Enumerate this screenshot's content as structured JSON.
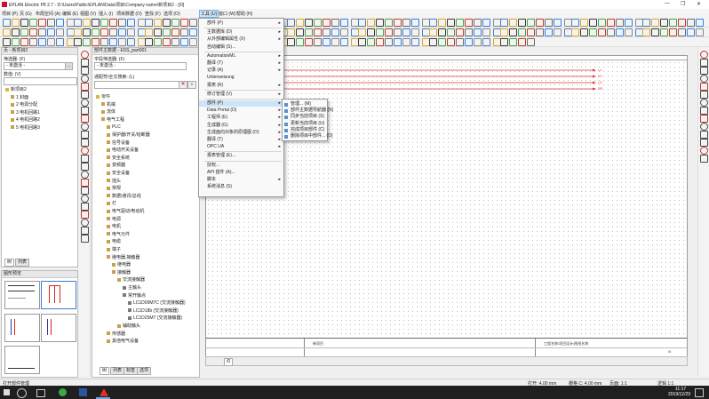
{
  "window": {
    "title": "EPLAN Electric P8 2.7 - D:\\Users\\Public\\EPLAN\\Data\\项目\\Company name\\新项目2 - [/0]",
    "controls": [
      "—",
      "❐",
      "✕"
    ]
  },
  "menubar": {
    "items": [
      "项目 (P)",
      "页 (G)",
      "布局空间 (A)",
      "编辑 (E)",
      "视图 (V)",
      "插入 (I)",
      "项目数据 (O)",
      "查找 (F)",
      "选项 (O)",
      "工具 (U)",
      "窗口 (W)",
      "帮助 (H)"
    ],
    "active_index": 9
  },
  "page_navigator": {
    "title": "页 - 新项目2",
    "filter_label": "筛选器: (F)",
    "filter_value": "- 未激活 -",
    "value_label": "数值: (V)",
    "tree": [
      {
        "label": "新项目2",
        "level": 0
      },
      {
        "label": "1 封面",
        "level": 1
      },
      {
        "label": "2 电源分配",
        "level": 1
      },
      {
        "label": "3 电机回路1",
        "level": 1
      },
      {
        "label": "4 电机回路2",
        "level": 1
      },
      {
        "label": "5 电机回路3",
        "level": 1
      }
    ],
    "tabs": [
      "树",
      "列表"
    ]
  },
  "graphic_preview": {
    "title": "图形预览"
  },
  "parts_navigator": {
    "title": "部件主数据 - ESS_part001",
    "field_label": "字段筛选器: (F)",
    "field_value": "- 未激活 -",
    "fulltext_label": "通配符/全文搜索: (L)",
    "tree": [
      {
        "label": "零件",
        "level": 0
      },
      {
        "label": "机械",
        "level": 1
      },
      {
        "label": "流体",
        "level": 1
      },
      {
        "label": "电气工程",
        "level": 1
      },
      {
        "label": "PLC",
        "level": 2
      },
      {
        "label": "保护器/开关/熔断器",
        "level": 2
      },
      {
        "label": "信号设备",
        "level": 2
      },
      {
        "label": "电动开关设备",
        "level": 2
      },
      {
        "label": "安全系统",
        "level": 2
      },
      {
        "label": "变频器",
        "level": 2
      },
      {
        "label": "安全设备",
        "level": 2
      },
      {
        "label": "插头",
        "level": 2
      },
      {
        "label": "常规",
        "level": 2
      },
      {
        "label": "数据/通讯/总线",
        "level": 2
      },
      {
        "label": "灯",
        "level": 2
      },
      {
        "label": "电气驱动/电动机",
        "level": 2
      },
      {
        "label": "电源",
        "level": 2
      },
      {
        "label": "电机",
        "level": 2
      },
      {
        "label": "电气元件",
        "level": 2
      },
      {
        "label": "电缆",
        "level": 2
      },
      {
        "label": "端子",
        "level": 2
      },
      {
        "label": "继电器,接触器",
        "level": 2
      },
      {
        "label": "继电器",
        "level": 3
      },
      {
        "label": "接触器",
        "level": 3
      },
      {
        "label": "交流接触器",
        "level": 4
      },
      {
        "label": "主触头",
        "level": 5
      },
      {
        "label": "常开触点",
        "level": 5
      },
      {
        "label": "LC1D09M7C (交流接触器)",
        "level": 6
      },
      {
        "label": "LC1D18b (交流接触器)",
        "level": 6
      },
      {
        "label": "LC1D25M7 (交流接触器)",
        "level": 6
      },
      {
        "label": "辅助触头",
        "level": 4
      },
      {
        "label": "传感器",
        "level": 2
      },
      {
        "label": "其他电气设备",
        "level": 2
      }
    ],
    "tabs": [
      "树",
      "列表",
      "标签",
      "选项"
    ]
  },
  "tools_menu": {
    "items": [
      {
        "label": "部件 (P)",
        "submenu": true
      },
      {
        "label": "主数据库 (D)",
        "submenu": true
      },
      {
        "label": "从外部编辑属性 (X)",
        "submenu": true
      },
      {
        "label": "自动编辑 (S)...",
        "submenu": false
      },
      {
        "label": "AutomationML",
        "submenu": true
      },
      {
        "label": "翻译 (T)",
        "submenu": true
      },
      {
        "label": "记录 (A)",
        "submenu": true
      },
      {
        "label": "Unterweisung",
        "submenu": false
      },
      {
        "label": "报表 (R)",
        "submenu": true
      },
      {
        "label": "修订管理 (V)",
        "submenu": true
      },
      {
        "label": "部件 (P)",
        "submenu": true,
        "highlight": true
      },
      {
        "label": "Data Portal (D)",
        "submenu": true
      },
      {
        "label": "工程师 (E)",
        "submenu": true
      },
      {
        "label": "生成器 (G)",
        "submenu": true
      },
      {
        "label": "生成面向对象的原理图 (O)",
        "submenu": true
      },
      {
        "label": "翻译 (T)",
        "submenu": true
      },
      {
        "label": "OPC UA",
        "submenu": true
      },
      {
        "label": "报表管理 (E)...",
        "submenu": false
      },
      {
        "label": "授权...",
        "submenu": false
      },
      {
        "label": "API 插件 (A)...",
        "submenu": false
      },
      {
        "label": "脚本",
        "submenu": true
      },
      {
        "label": "系统消息 (S)",
        "submenu": false
      }
    ]
  },
  "parts_submenu": {
    "items": [
      "管理... (M)",
      "部件主数据导航器 (N)",
      "同步当前项目 (S)",
      "更新当前项目 (U)",
      "完成项目部件 (C)",
      "删除项目中部件... (D)"
    ]
  },
  "schematic": {
    "wire_labels": [
      "L1",
      "L2",
      "L3",
      "PE"
    ],
    "wire_color": "#e23030",
    "title_block": {
      "company": "新项目",
      "desc": "工程名称/项目设计/图纸名称",
      "page": "/0"
    },
    "page_tab": "/0"
  },
  "statusbar": {
    "left_text": "打开部件管理",
    "coords": "打开: 4.00 mm",
    "grid": "栅格 C: 4.00 mm",
    "zoom": "页面: 1:1",
    "logic": "逻辑 1:1"
  },
  "taskbar": {
    "time": "11:17",
    "date": "2019/12/29"
  }
}
